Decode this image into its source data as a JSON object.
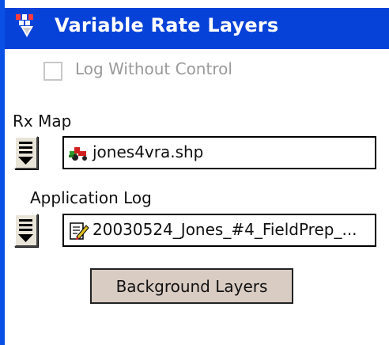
{
  "window": {
    "title": "Variable Rate Layers"
  },
  "options": {
    "log_without_control_label": "Log Without Control",
    "log_without_control_checked": false
  },
  "rx_map": {
    "label": "Rx Map",
    "value": "jones4vra.shp"
  },
  "application_log": {
    "label": "Application Log",
    "value": "20030524_Jones_#4_FieldPrep_..."
  },
  "buttons": {
    "background_layers": "Background Layers"
  },
  "icons": {
    "title": "layers-app-icon",
    "rx_map": "tractor-map-icon",
    "application_log": "log-edit-icon",
    "dropdown": "list-dropdown-icon"
  },
  "colors": {
    "title_bar": "#0742d8",
    "left_edge": "#0a50e6",
    "button_face": "#d9ccc3",
    "dropdown_face": "#e9e4d8"
  }
}
